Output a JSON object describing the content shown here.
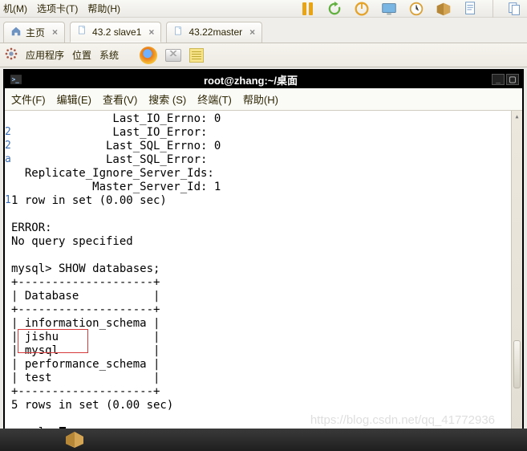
{
  "top_menu": {
    "machine": "机(M)",
    "tabs": "选项卡(T)",
    "help": "帮助(H)"
  },
  "app_tabs": {
    "home": "主页",
    "slave": "43.2 slave1",
    "master": "43.22master"
  },
  "host_toolbar": {
    "apps": "应用程序",
    "location": "位置",
    "system": "系统"
  },
  "terminal": {
    "title": "root@zhang:~/桌面",
    "menu": {
      "file": "文件(F)",
      "edit": "编辑(E)",
      "view": "查看(V)",
      "search": "搜索 (S)",
      "terminal": "终端(T)",
      "help": "帮助(H)"
    },
    "lines": [
      "               Last_IO_Errno: 0",
      "               Last_IO_Error:",
      "              Last_SQL_Errno: 0",
      "              Last_SQL_Error:",
      "  Replicate_Ignore_Server_Ids:",
      "            Master_Server_Id: 1",
      "1 row in set (0.00 sec)",
      "",
      "ERROR:",
      "No query specified",
      "",
      "mysql> SHOW databases;",
      "+--------------------+",
      "| Database           |",
      "+--------------------+",
      "| information_schema |",
      "| jishu              |",
      "| mysql              |",
      "| performance_schema |",
      "| test               |",
      "+--------------------+",
      "5 rows in set (0.00 sec)",
      "",
      "mysql> "
    ],
    "gutter_hints": [
      "2",
      "2",
      "a",
      "1",
      "1"
    ]
  },
  "watermark": "https://blog.csdn.net/qq_41772936"
}
